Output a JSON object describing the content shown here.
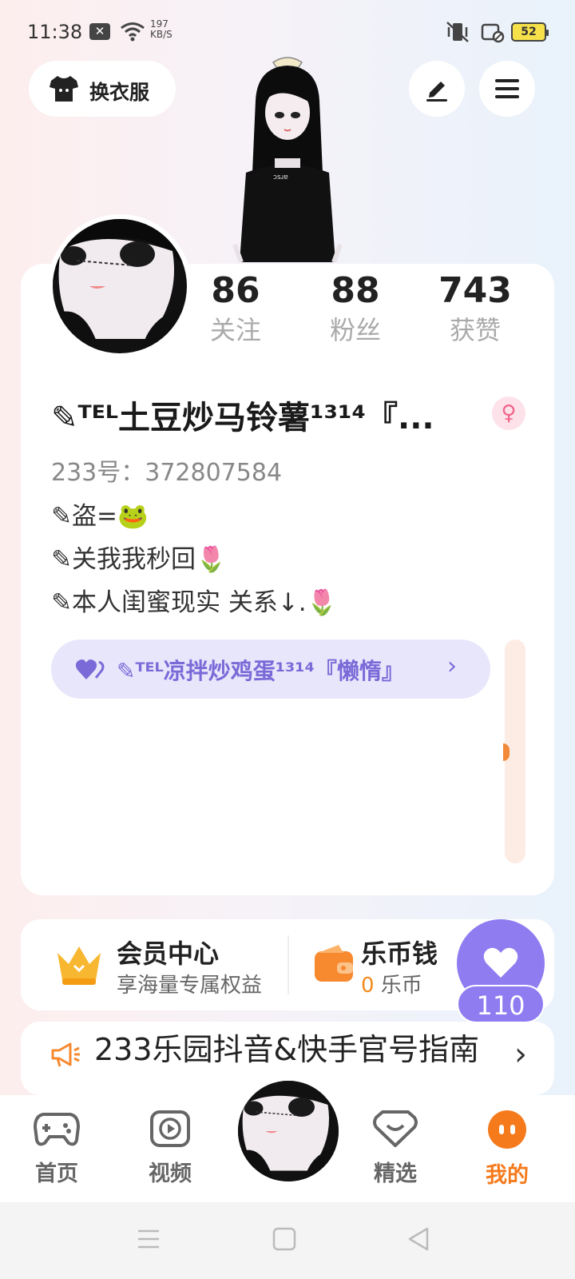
{
  "status_bar": {
    "time": "11:38",
    "speed_value": "197",
    "speed_unit": "KB/S",
    "battery": "52"
  },
  "top_bar": {
    "outfit_label": "换衣服"
  },
  "profile": {
    "stats": [
      {
        "value": "86",
        "label": "关注"
      },
      {
        "value": "88",
        "label": "粉丝"
      },
      {
        "value": "743",
        "label": "获赞"
      }
    ],
    "username": "✎ᵀᴱᴸ土豆炒马铃薯¹³¹⁴『...",
    "gender_symbol": "♀",
    "user_id": "233号：372807584",
    "bio_lines": [
      "✎盗=🐸",
      "✎关我我秒回🌷",
      "✎本人闺蜜现实 关系↓.🌷"
    ],
    "friend_chip": {
      "name": "✎ᵀᴱᴸ凉拌炒鸡蛋¹³¹⁴『懒惰』",
      "chevron": "›"
    }
  },
  "services": {
    "member_title": "会员中心",
    "member_sub": "享海量专属权益",
    "wallet_title": "乐币钱",
    "wallet_amount": "0",
    "wallet_unit": " 乐币"
  },
  "like_float": {
    "count": "110"
  },
  "notice": {
    "text": "233乐园抖音&快手官号指南",
    "chevron": "›"
  },
  "bottom_nav": {
    "items": [
      {
        "label": "首页",
        "icon": "gamepad-icon"
      },
      {
        "label": "视频",
        "icon": "play-icon"
      },
      {
        "label": "精选",
        "icon": "heart-tag-icon"
      },
      {
        "label": "我的",
        "icon": "face-icon"
      }
    ],
    "active": "我的"
  },
  "colors": {
    "accent_orange": "#f57a1c",
    "accent_purple": "#8e7cf0"
  }
}
